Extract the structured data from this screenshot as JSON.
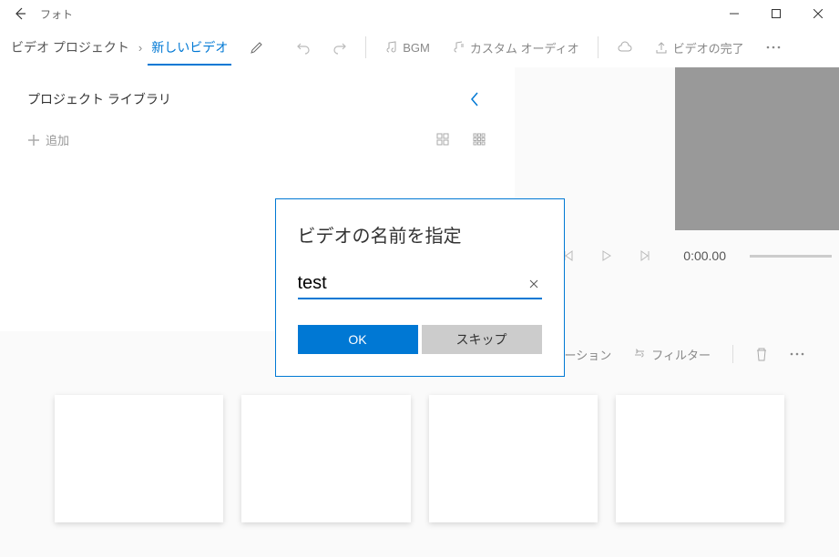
{
  "titlebar": {
    "app_name": "フォト"
  },
  "breadcrumb": {
    "root": "ビデオ プロジェクト",
    "current": "新しいビデオ"
  },
  "toolbar": {
    "bgm": "BGM",
    "custom_audio": "カスタム オーディオ",
    "finish": "ビデオの完了"
  },
  "library": {
    "title": "プロジェクト ライブラリ",
    "add_label": "追加"
  },
  "preview": {
    "time": "0:00.00"
  },
  "story_toolbar": {
    "duration": "ーション",
    "filters": "フィルター"
  },
  "dialog": {
    "title": "ビデオの名前を指定",
    "input_value": "test",
    "ok_label": "OK",
    "skip_label": "スキップ"
  }
}
